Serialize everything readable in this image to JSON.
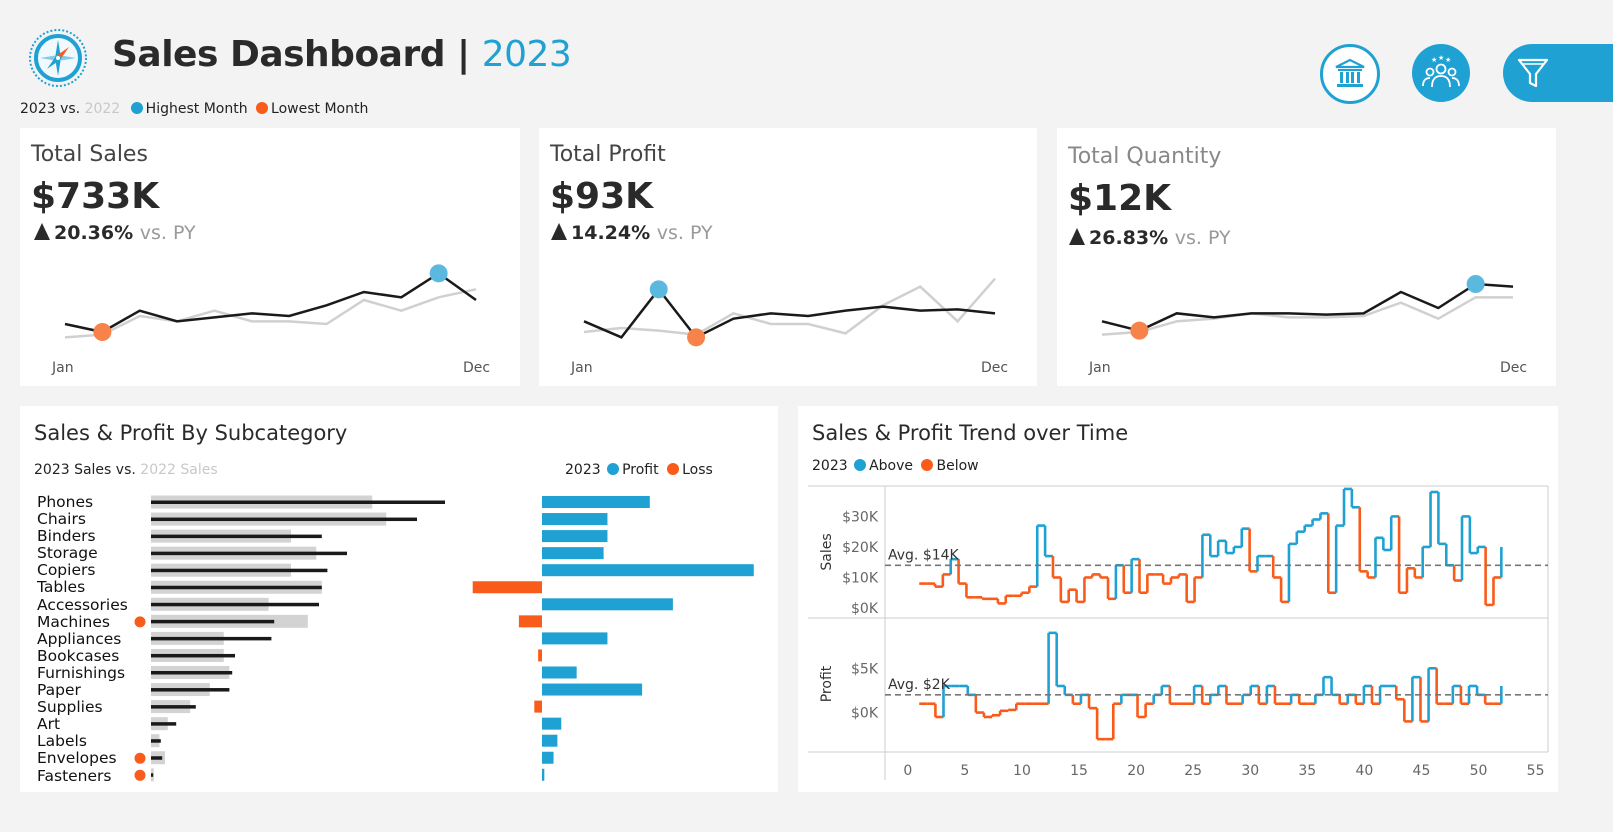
{
  "header": {
    "title": "Sales Dashboard |",
    "year": "2023",
    "legend": {
      "current": "2023",
      "vs": "vs.",
      "previous": "2022",
      "highest": "Highest Month",
      "lowest": "Lowest Month"
    },
    "icons": [
      "compass-logo-icon",
      "bank-icon",
      "people-icon",
      "filter-icon"
    ]
  },
  "kpis": [
    {
      "label": "Total Sales",
      "value": "$733K",
      "delta": "20.36%",
      "vs": "vs. PY",
      "start": "Jan",
      "end": "Dec",
      "current": [
        38,
        32,
        48,
        40,
        43,
        46,
        44,
        52,
        62,
        58,
        76,
        56
      ],
      "previous": [
        28,
        30,
        44,
        40,
        48,
        40,
        40,
        38,
        56,
        48,
        58,
        64
      ],
      "highest_index": 10,
      "lowest_index": 1
    },
    {
      "label": "Total Profit",
      "value": "$93K",
      "delta": "14.24%",
      "vs": "vs. PY",
      "start": "Jan",
      "end": "Dec",
      "current": [
        40,
        28,
        64,
        28,
        42,
        46,
        44,
        48,
        51,
        48,
        49,
        46
      ],
      "previous": [
        32,
        35,
        33,
        30,
        46,
        38,
        38,
        31,
        52,
        66,
        40,
        72
      ],
      "highest_index": 2,
      "lowest_index": 3
    },
    {
      "label": "Total Quantity",
      "value": "$12K",
      "delta": "26.83%",
      "vs": "vs. PY",
      "start": "Jan",
      "end": "Dec",
      "current": [
        40,
        33,
        46,
        43,
        46,
        46,
        45,
        46,
        62,
        50,
        68,
        66
      ],
      "previous": [
        30,
        32,
        40,
        42,
        46,
        43,
        43,
        44,
        54,
        42,
        58,
        58
      ],
      "highest_index": 10,
      "lowest_index": 1
    }
  ],
  "subcategory": {
    "title": "Sales & Profit By Subcategory",
    "legend_left_current": "2023 Sales vs.",
    "legend_left_previous": "2022 Sales",
    "legend_right_year": "2023",
    "legend_profit": "Profit",
    "legend_loss": "Loss",
    "colors": {
      "profit": "#1fa2d3",
      "loss": "#f95b1a",
      "current": "#1a1a1a",
      "previous": "#d3d3d3"
    },
    "rows": [
      {
        "name": "Phones",
        "sales2023": 105,
        "sales2022": 79,
        "profit": 14,
        "loss_marker": false
      },
      {
        "name": "Chairs",
        "sales2023": 95,
        "sales2022": 84,
        "profit": 8.5,
        "loss_marker": false
      },
      {
        "name": "Binders",
        "sales2023": 61,
        "sales2022": 50,
        "profit": 8.5,
        "loss_marker": false
      },
      {
        "name": "Storage",
        "sales2023": 70,
        "sales2022": 59,
        "profit": 8,
        "loss_marker": false
      },
      {
        "name": "Copiers",
        "sales2023": 63,
        "sales2022": 50,
        "profit": 27.5,
        "loss_marker": false
      },
      {
        "name": "Tables",
        "sales2023": 61,
        "sales2022": 61,
        "profit": -9,
        "loss_marker": false
      },
      {
        "name": "Accessories",
        "sales2023": 60,
        "sales2022": 42,
        "profit": 17,
        "loss_marker": false
      },
      {
        "name": "Machines",
        "sales2023": 44,
        "sales2022": 56,
        "profit": -3,
        "loss_marker": true
      },
      {
        "name": "Appliances",
        "sales2023": 43,
        "sales2022": 26,
        "profit": 8.5,
        "loss_marker": false
      },
      {
        "name": "Bookcases",
        "sales2023": 30,
        "sales2022": 26,
        "profit": -0.5,
        "loss_marker": false
      },
      {
        "name": "Furnishings",
        "sales2023": 29,
        "sales2022": 28,
        "profit": 4.5,
        "loss_marker": false
      },
      {
        "name": "Paper",
        "sales2023": 28,
        "sales2022": 21,
        "profit": 13,
        "loss_marker": false
      },
      {
        "name": "Supplies",
        "sales2023": 16,
        "sales2022": 14,
        "profit": -1,
        "loss_marker": false
      },
      {
        "name": "Art",
        "sales2023": 9,
        "sales2022": 6,
        "profit": 2.5,
        "loss_marker": false
      },
      {
        "name": "Labels",
        "sales2023": 3.5,
        "sales2022": 3,
        "profit": 2,
        "loss_marker": false
      },
      {
        "name": "Envelopes",
        "sales2023": 4,
        "sales2022": 5,
        "profit": 1.5,
        "loss_marker": true
      },
      {
        "name": "Fasteners",
        "sales2023": 0.8,
        "sales2022": 1,
        "profit": 0.3,
        "loss_marker": true
      }
    ]
  },
  "trend": {
    "title": "Sales & Profit Trend over Time",
    "legend_year": "2023",
    "legend_above": "Above",
    "legend_below": "Below",
    "sales_label": "Sales",
    "profit_label": "Profit",
    "sales_avg_label": "Avg. $14K",
    "profit_avg_label": "Avg. $2K",
    "sales_ticks": [
      "$0K",
      "$10K",
      "$20K",
      "$30K"
    ],
    "profit_ticks": [
      "$0K",
      "$5K"
    ],
    "x_ticks": [
      "0",
      "5",
      "10",
      "15",
      "20",
      "25",
      "30",
      "35",
      "40",
      "45",
      "50",
      "55"
    ],
    "chart_data": {
      "type": "line",
      "x": [
        1,
        2,
        3,
        4,
        5,
        6,
        7,
        8,
        9,
        10,
        11,
        12,
        13,
        14,
        15,
        16,
        17,
        18,
        19,
        20,
        21,
        22,
        23,
        24,
        25,
        26,
        27,
        28,
        29,
        30,
        31,
        32,
        33,
        34,
        35,
        36,
        37,
        38,
        39,
        40,
        41,
        42,
        43,
        44,
        45,
        46,
        47,
        48,
        49,
        50,
        51,
        52
      ],
      "sales_avg": 14,
      "profit_avg": 2,
      "series": [
        {
          "name": "Sales",
          "values": [
            8,
            8,
            7,
            11,
            16,
            8,
            3.5,
            3.5,
            3,
            3,
            1.5,
            4,
            4,
            5,
            7,
            27,
            17,
            10,
            2,
            6,
            2,
            10,
            11,
            10,
            3,
            14,
            5,
            16,
            5,
            11,
            11,
            8,
            10,
            11,
            2,
            10,
            24,
            17,
            22,
            18,
            20,
            26,
            12,
            17,
            17,
            10,
            2,
            21,
            25,
            27,
            29,
            31,
            5,
            27,
            39,
            33,
            12,
            10,
            23,
            19,
            30,
            5,
            13,
            10,
            20,
            38,
            21,
            14,
            9,
            30,
            18,
            20,
            1,
            10,
            20
          ]
        },
        {
          "name": "Profit",
          "values": [
            1,
            1,
            -0.5,
            3,
            3,
            3,
            2,
            0,
            -0.5,
            -0.3,
            0.2,
            0.3,
            1,
            1,
            1,
            1,
            9,
            3,
            2,
            1,
            2,
            0.5,
            -3,
            -3,
            1,
            2,
            2,
            -0.5,
            1,
            2,
            3,
            1,
            1,
            1,
            3,
            1,
            2,
            3,
            1,
            1,
            2,
            3,
            1,
            3,
            1,
            1,
            2,
            1,
            1,
            2,
            4,
            2,
            1,
            2,
            1,
            3,
            1,
            3,
            3,
            1.5,
            -1,
            4,
            -1,
            5,
            1,
            1,
            3,
            1,
            3,
            2,
            1,
            1,
            3
          ]
        }
      ]
    }
  }
}
